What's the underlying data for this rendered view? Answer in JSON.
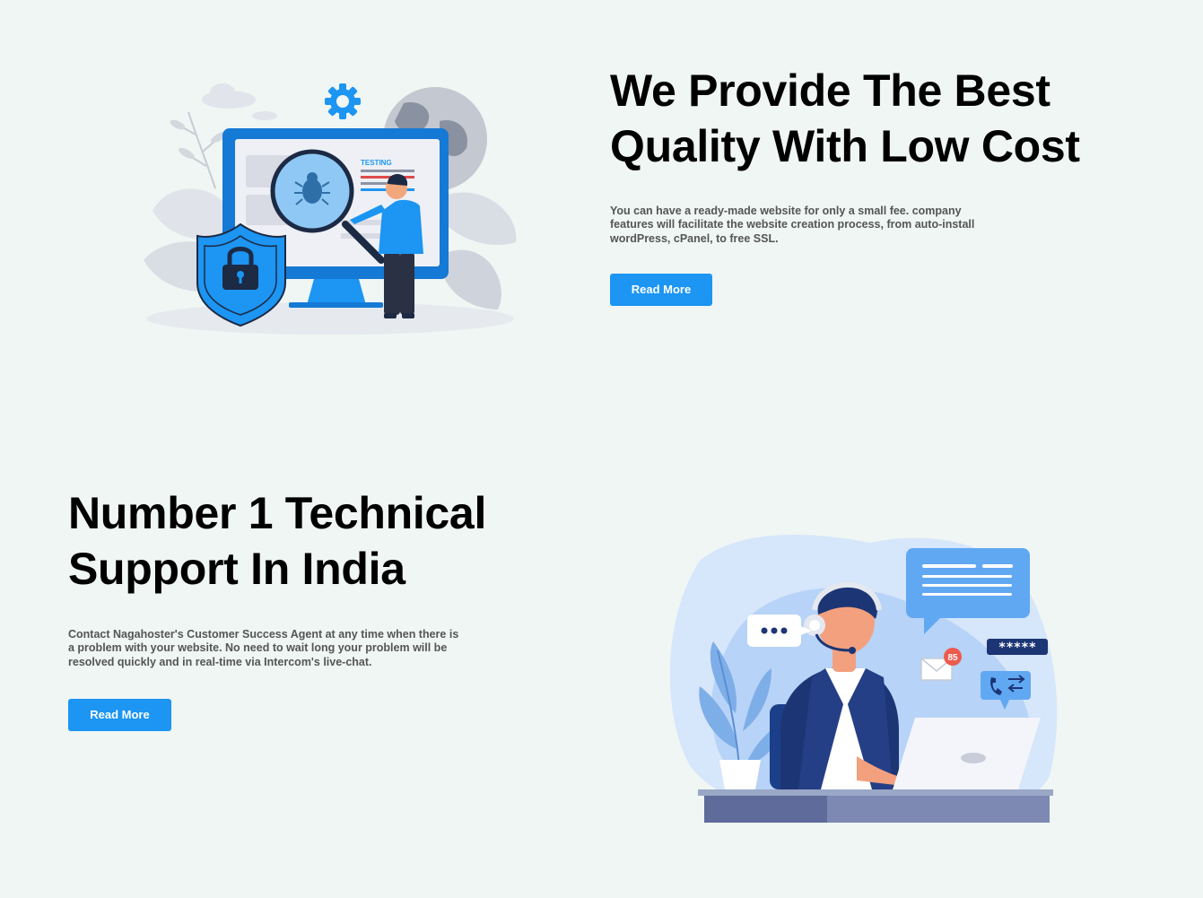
{
  "section1": {
    "heading_line1": "We Provide The Best",
    "heading_line2": "Quality With Low Cost",
    "description": "You can have a ready-made website for only a small fee. company features will facilitate the website creation process, from auto-install wordPress, cPanel, to free SSL.",
    "button_label": "Read More",
    "illustration": {
      "screen_label": "TESTING",
      "icons": [
        "gear-icon",
        "globe-icon",
        "shield-lock-icon",
        "magnifier-bug-icon"
      ]
    }
  },
  "section2": {
    "heading_line1": "Number 1 Technical",
    "heading_line2": "Support In India",
    "description": "Contact Nagahoster's Customer Success Agent at any time when there is a problem with your website. No need to wait long your problem will be resolved quickly and in real-time via Intercom's live-chat.",
    "button_label": "Read More",
    "illustration": {
      "notification_count": "85",
      "password_mask": "*****",
      "icons": [
        "chat-bubble-icon",
        "typing-bubble-icon",
        "mail-icon",
        "phone-transfer-icon",
        "password-icon",
        "plant-icon",
        "laptop-icon"
      ]
    }
  },
  "colors": {
    "background": "#eff6f3",
    "accent": "#1c95f3",
    "heading": "#000000",
    "text": "#555555"
  }
}
